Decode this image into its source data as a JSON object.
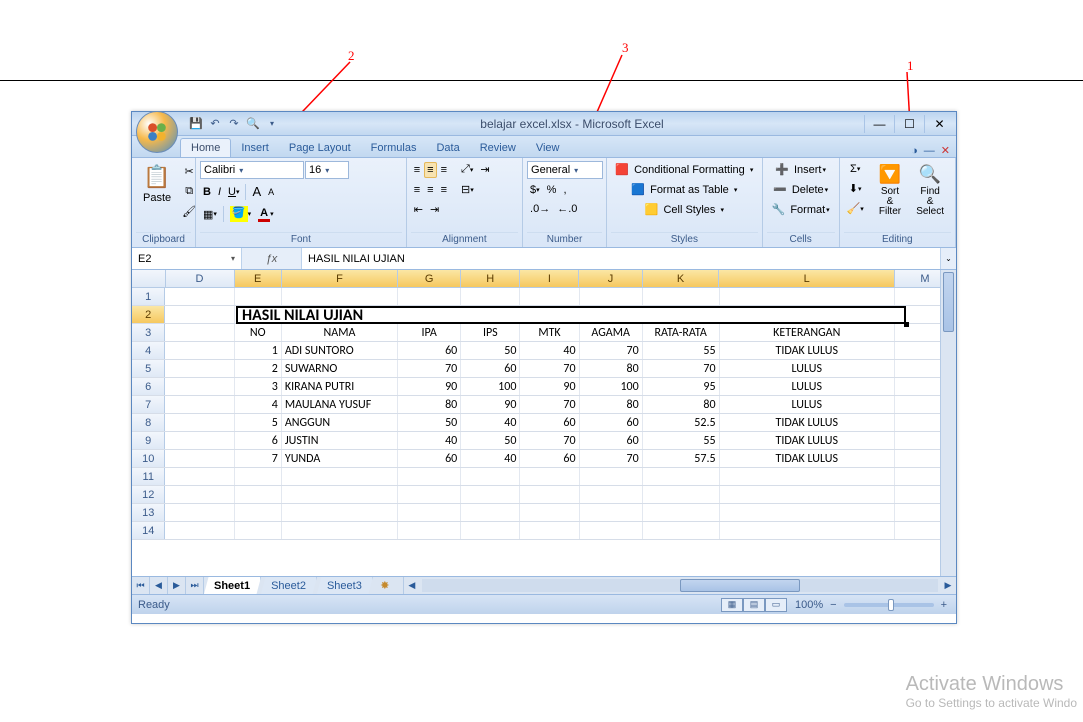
{
  "annotations": {
    "a1": "1",
    "a2": "2",
    "a3": "3"
  },
  "window": {
    "title": "belajar excel.xlsx - Microsoft Excel",
    "qat": {
      "save": "💾",
      "undo": "↶",
      "redo": "↷",
      "print": "🔍"
    }
  },
  "tabs": [
    "Home",
    "Insert",
    "Page Layout",
    "Formulas",
    "Data",
    "Review",
    "View"
  ],
  "ribbon": {
    "clipboard": {
      "label": "Clipboard",
      "paste": "Paste"
    },
    "font": {
      "label": "Font",
      "name": "Calibri",
      "size": "16"
    },
    "alignment": {
      "label": "Alignment"
    },
    "number": {
      "label": "Number",
      "format": "General"
    },
    "styles": {
      "label": "Styles",
      "cond": "Conditional Formatting",
      "table": "Format as Table",
      "cell": "Cell Styles"
    },
    "cells": {
      "label": "Cells",
      "insert": "Insert",
      "delete": "Delete",
      "format": "Format"
    },
    "editing": {
      "label": "Editing",
      "sort": "Sort & Filter",
      "find": "Find & Select"
    }
  },
  "namebox": "E2",
  "formula": "HASIL NILAI UJIAN",
  "columns": [
    "D",
    "E",
    "F",
    "G",
    "H",
    "I",
    "J",
    "K",
    "L",
    "M"
  ],
  "rowNums": [
    "1",
    "2",
    "3",
    "4",
    "5",
    "6",
    "7",
    "8",
    "9",
    "10",
    "11",
    "12",
    "13",
    "14"
  ],
  "mergedTitle": "HASIL NILAI UJIAN",
  "headerRow": {
    "no": "NO",
    "nama": "NAMA",
    "ipa": "IPA",
    "ips": "IPS",
    "mtk": "MTK",
    "agama": "AGAMA",
    "rata": "RATA-RATA",
    "ket": "KETERANGAN"
  },
  "data": [
    {
      "no": "1",
      "nama": "ADI SUNTORO",
      "ipa": "60",
      "ips": "50",
      "mtk": "40",
      "agama": "70",
      "rata": "55",
      "ket": "TIDAK LULUS"
    },
    {
      "no": "2",
      "nama": "SUWARNO",
      "ipa": "70",
      "ips": "60",
      "mtk": "70",
      "agama": "80",
      "rata": "70",
      "ket": "LULUS"
    },
    {
      "no": "3",
      "nama": "KIRANA PUTRI",
      "ipa": "90",
      "ips": "100",
      "mtk": "90",
      "agama": "100",
      "rata": "95",
      "ket": "LULUS"
    },
    {
      "no": "4",
      "nama": "MAULANA YUSUF",
      "ipa": "80",
      "ips": "90",
      "mtk": "70",
      "agama": "80",
      "rata": "80",
      "ket": "LULUS"
    },
    {
      "no": "5",
      "nama": "ANGGUN",
      "ipa": "50",
      "ips": "40",
      "mtk": "60",
      "agama": "60",
      "rata": "52.5",
      "ket": "TIDAK LULUS"
    },
    {
      "no": "6",
      "nama": "JUSTIN",
      "ipa": "40",
      "ips": "50",
      "mtk": "70",
      "agama": "60",
      "rata": "55",
      "ket": "TIDAK LULUS"
    },
    {
      "no": "7",
      "nama": "YUNDA",
      "ipa": "60",
      "ips": "40",
      "mtk": "60",
      "agama": "70",
      "rata": "57.5",
      "ket": "TIDAK LULUS"
    }
  ],
  "sheets": [
    "Sheet1",
    "Sheet2",
    "Sheet3"
  ],
  "status": {
    "ready": "Ready",
    "zoom": "100%"
  },
  "watermark": {
    "title": "Activate Windows",
    "sub": "Go to Settings to activate Windo"
  }
}
